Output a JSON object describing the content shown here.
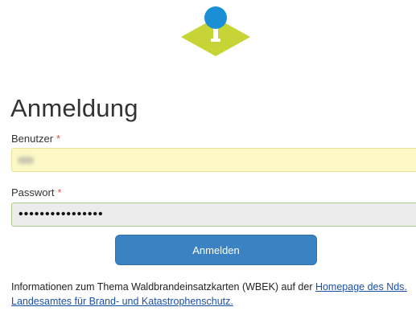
{
  "logo": {
    "icon": "map-pin-logo-icon",
    "pin_color": "#1a8fd6",
    "diamond_color": "#c6d435"
  },
  "form": {
    "title": "Anmeldung",
    "user_label": "Benutzer",
    "user_value": "",
    "password_label": "Passwort",
    "password_value": "••••••••••••••••",
    "required_marker": "*",
    "submit_label": "Anmelden"
  },
  "info": {
    "text": "Informationen zum Thema Waldbrandeinsatzkarten (WBEK) auf der ",
    "link_line1": "Homepage des Nds.",
    "link_line2": "Landesamtes für Brand- und Katastrophenschutz."
  }
}
